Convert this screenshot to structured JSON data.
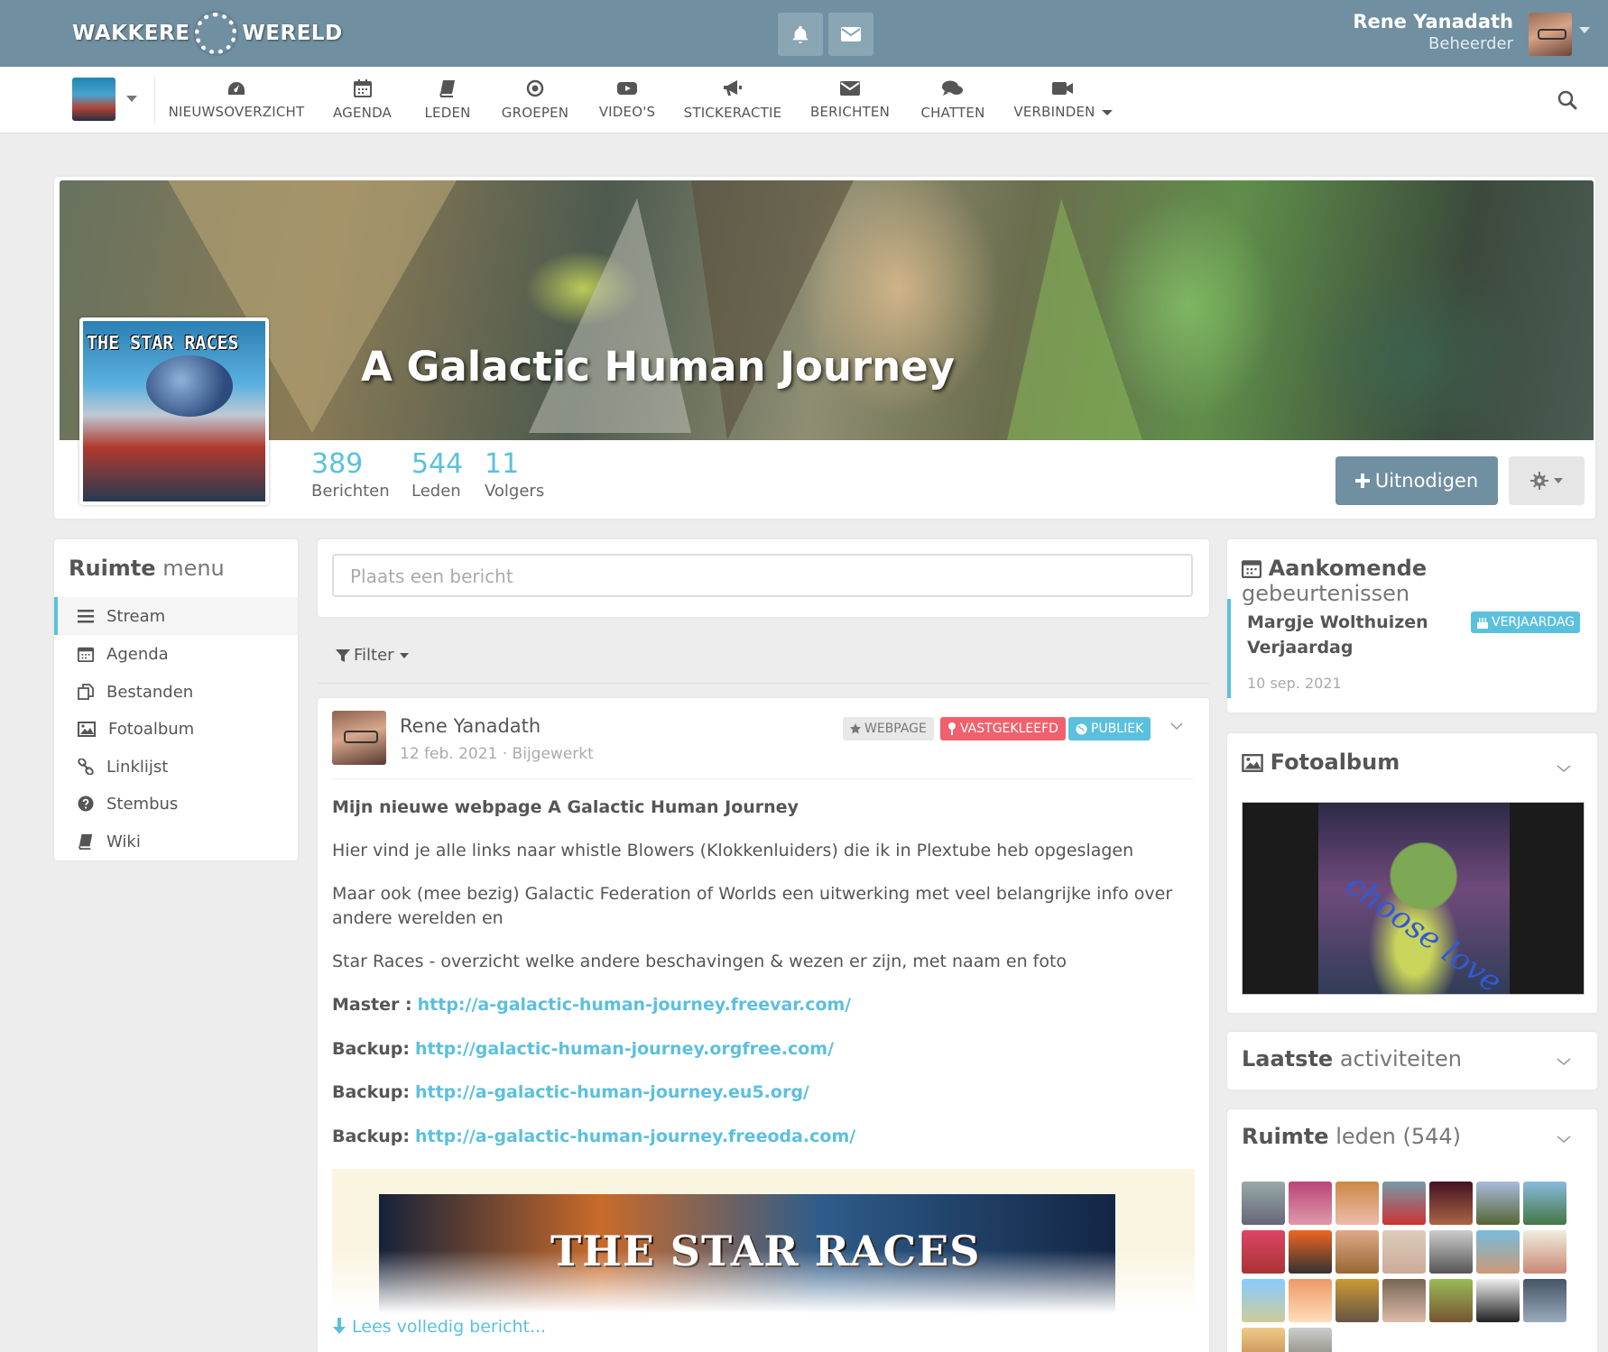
{
  "topbar": {
    "logo_left": "WAKKERE",
    "logo_right": "WERELD",
    "user_name": "Rene Yanadath",
    "user_role": "Beheerder",
    "icons": [
      "bell-icon",
      "envelope-icon"
    ]
  },
  "nav": {
    "items": [
      {
        "label": "NIEUWSOVERZICHT",
        "icon": "dashboard-icon"
      },
      {
        "label": "AGENDA",
        "icon": "calendar-icon"
      },
      {
        "label": "LEDEN",
        "icon": "book-icon"
      },
      {
        "label": "GROEPEN",
        "icon": "circle-dot-icon"
      },
      {
        "label": "VIDEO'S",
        "icon": "youtube-icon"
      },
      {
        "label": "STICKERACTIE",
        "icon": "megaphone-icon"
      },
      {
        "label": "BERICHTEN",
        "icon": "envelope-icon"
      },
      {
        "label": "CHATTEN",
        "icon": "comments-icon"
      },
      {
        "label": "VERBINDEN",
        "icon": "video-camera-icon"
      }
    ]
  },
  "space": {
    "title": "A Galactic Human Journey",
    "logo_text": "THE STAR RACES",
    "stats": [
      {
        "value": "389",
        "label": "Berichten"
      },
      {
        "value": "544",
        "label": "Leden"
      },
      {
        "value": "11",
        "label": "Volgers"
      }
    ],
    "invite_label": "Uitnodigen"
  },
  "menu": {
    "title_bold": "Ruimte",
    "title_light": "menu",
    "items": [
      {
        "label": "Stream",
        "icon": "bars-icon"
      },
      {
        "label": "Agenda",
        "icon": "calendar-icon"
      },
      {
        "label": "Bestanden",
        "icon": "files-icon"
      },
      {
        "label": "Fotoalbum",
        "icon": "image-icon"
      },
      {
        "label": "Linklijst",
        "icon": "link-icon"
      },
      {
        "label": "Stembus",
        "icon": "question-circle-icon"
      },
      {
        "label": "Wiki",
        "icon": "book-icon"
      }
    ]
  },
  "stream": {
    "composer_placeholder": "Plaats een bericht",
    "filter_label": "Filter"
  },
  "post": {
    "author": "Rene Yanadath",
    "meta": "12 feb. 2021 · Bijgewerkt",
    "labels": {
      "webpage": "WEBPAGE",
      "pinned": "VASTGEKLEEFD",
      "public": "PUBLIEK"
    },
    "heading": "Mijn nieuwe webpage A Galactic Human Journey",
    "p1": "Hier vind je alle links naar whistle Blowers (Klokkenluiders) die ik in Plextube heb opgeslagen",
    "p2": "Maar ook (mee bezig) Galactic Federation of Worlds een uitwerking met veel belangrijke info over andere werelden en",
    "p3": "Star Races - overzicht welke andere beschavingen & wezen er zijn, met naam en foto",
    "links": [
      {
        "prefix": "Master :",
        "url": "http://a-galactic-human-journey.freevar.com/"
      },
      {
        "prefix": "Backup:",
        "url": "http://galactic-human-journey.orgfree.com/"
      },
      {
        "prefix": "Backup:",
        "url": "http://a-galactic-human-journey.eu5.org/"
      },
      {
        "prefix": "Backup:",
        "url": "http://a-galactic-human-journey.freeoda.com/"
      }
    ],
    "image_text": "THE STAR RACES",
    "read_more": "Lees volledig bericht..."
  },
  "sidebar": {
    "events": {
      "title_bold": "Aankomende",
      "title_light": "gebeurtenissen",
      "event_title": "Margje Wolthuizen Verjaardag",
      "event_badge": "VERJAARDAG",
      "event_date": "10 sep. 2021"
    },
    "photos": {
      "title": "Fotoalbum",
      "caption": "choose love"
    },
    "activities": {
      "title_bold": "Laatste",
      "title_light": "activiteiten"
    },
    "members": {
      "title_bold": "Ruimte",
      "title_light": "leden (544)"
    }
  },
  "colors": {
    "topbar": "#708fa0",
    "accent": "#5bc0de",
    "danger": "#f0616d",
    "default_label": "#e8e8e8"
  }
}
